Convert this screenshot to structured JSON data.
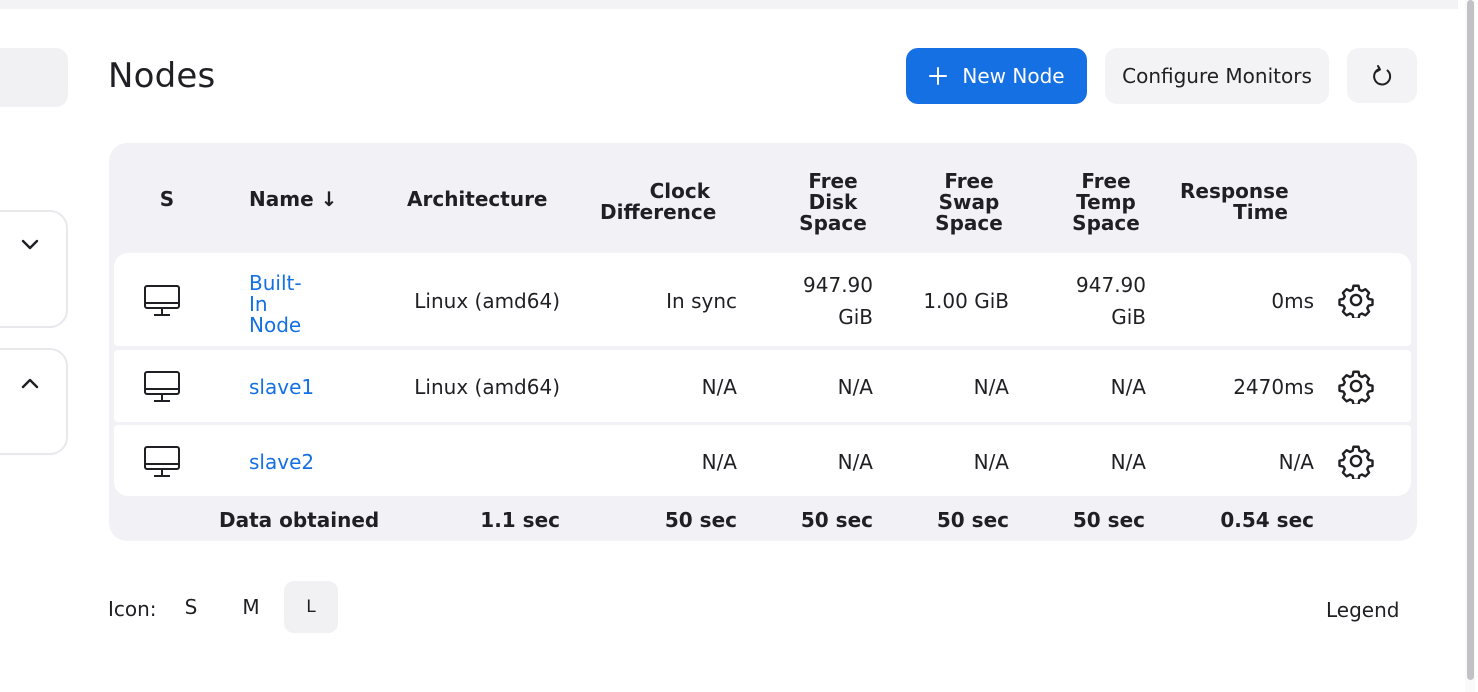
{
  "page": {
    "title": "Nodes"
  },
  "toolbar": {
    "new_node_label": "New Node",
    "configure_label": "Configure Monitors"
  },
  "table": {
    "headers": {
      "status": "S",
      "name": "Name ↓",
      "architecture": "Architecture",
      "clock_1": "Clock",
      "clock_2": "Difference",
      "disk_1": "Free",
      "disk_2": "Disk",
      "disk_3": "Space",
      "swap_1": "Free",
      "swap_2": "Swap",
      "swap_3": "Space",
      "temp_1": "Free",
      "temp_2": "Temp",
      "temp_3": "Space",
      "resp_1": "Response",
      "resp_2": "Time"
    },
    "rows": [
      {
        "name_1": "Built-",
        "name_2": "In",
        "name_3": "Node",
        "architecture": "Linux (amd64)",
        "clock": "In sync",
        "disk_1": "947.90",
        "disk_2": "GiB",
        "swap": "1.00 GiB",
        "temp_1": "947.90",
        "temp_2": "GiB",
        "response": "0ms"
      },
      {
        "name": "slave1",
        "architecture": "Linux (amd64)",
        "clock": "N/A",
        "disk": "N/A",
        "swap": "N/A",
        "temp": "N/A",
        "response": "2470ms"
      },
      {
        "name": "slave2",
        "architecture": "",
        "clock": "N/A",
        "disk": "N/A",
        "swap": "N/A",
        "temp": "N/A",
        "response": "N/A"
      }
    ],
    "footer": {
      "label": "Data obtained",
      "architecture": "1.1 sec",
      "clock": "50 sec",
      "disk": "50 sec",
      "swap": "50 sec",
      "temp": "50 sec",
      "response": "0.54 sec"
    }
  },
  "icon_size": {
    "label": "Icon:",
    "options": [
      "S",
      "M",
      "L"
    ],
    "selected": "L"
  },
  "legend_label": "Legend",
  "colors": {
    "accent": "#1570e3",
    "surface": "#f2f2f6"
  },
  "icons": [
    "plus-icon",
    "refresh-icon",
    "computer-icon",
    "gear-icon",
    "chevron-down-icon",
    "chevron-up-icon"
  ]
}
